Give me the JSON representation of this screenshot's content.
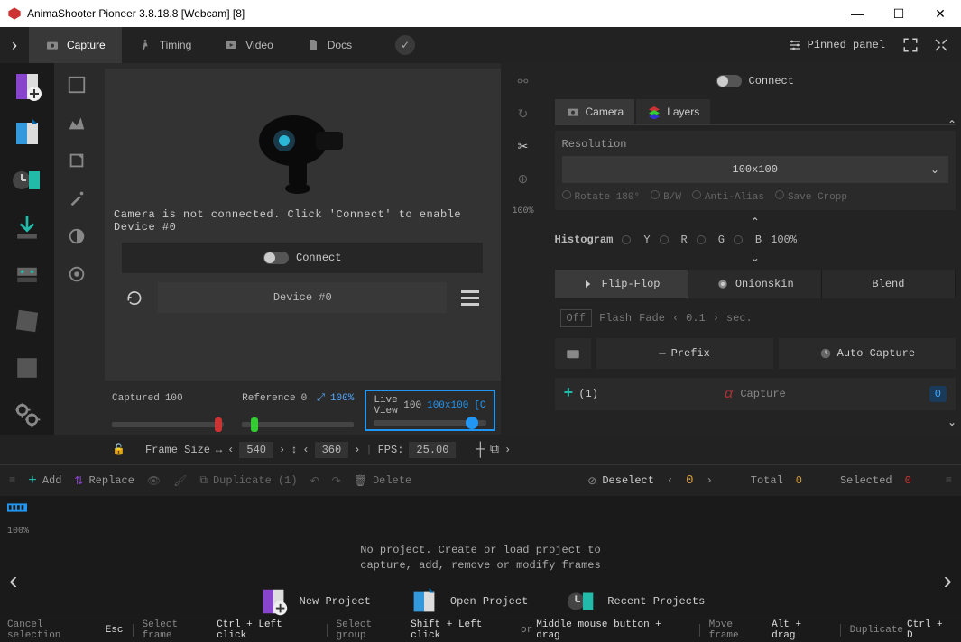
{
  "title": "AnimaShooter Pioneer 3.8.18.8 [Webcam] [8]",
  "tabs": {
    "capture": "Capture",
    "timing": "Timing",
    "video": "Video",
    "docs": "Docs"
  },
  "pinned_panel": "Pinned panel",
  "connect": "Connect",
  "preview": {
    "msg": "Camera is not connected. Click 'Connect' to enable Device #0",
    "connect": "Connect",
    "device": "Device #0"
  },
  "sliders": {
    "captured_label": "Captured",
    "captured_val": "100",
    "reference_label": "Reference",
    "reference_val": "0",
    "ref_pct": "100%",
    "live_label": "Live View",
    "live_val": "100",
    "live_res": "100x100",
    "live_c": "[C"
  },
  "sidecol_pct": "100%",
  "framebar": {
    "frame_size": "Frame Size",
    "w": "540",
    "h": "360",
    "fps_label": "FPS:",
    "fps": "25.00"
  },
  "editbar": {
    "add": "Add",
    "replace": "Replace",
    "duplicate": "Duplicate (1)",
    "delete": "Delete",
    "deselect": "Deselect",
    "cur": "0",
    "total_label": "Total",
    "total": "0",
    "selected_label": "Selected",
    "selected": "0"
  },
  "rightpanel": {
    "camera_tab": "Camera",
    "layers_tab": "Layers",
    "resolution_label": "Resolution",
    "resolution": "100x100",
    "rotate": "Rotate 180°",
    "bw": "B/W",
    "aa": "Anti-Alias",
    "save_crop": "Save Cropp",
    "histogram": "Histogram",
    "y": "Y",
    "r": "R",
    "g": "G",
    "b": "B",
    "hist_pct": "100%",
    "flipflop": "Flip-Flop",
    "onionskin": "Onionskin",
    "blend": "Blend",
    "off": "Off",
    "flash": "Flash",
    "fade": "Fade",
    "fade_val": "0.1",
    "sec": "sec.",
    "prefix": "Prefix",
    "autocap": "Auto Capture",
    "count": "(1)",
    "capture": "Capture",
    "zero": "0"
  },
  "timeline": {
    "pct": "100%",
    "msg": "No project. Create or load project to\ncapture, add, remove or modify frames",
    "new": "New Project",
    "open": "Open Project",
    "recent": "Recent Projects"
  },
  "status": {
    "cancel": "Cancel selection",
    "esc": "Esc",
    "select_frame": "Select frame",
    "ctrl_click": "Ctrl + Left click",
    "select_group": "Select group",
    "shift_click": "Shift + Left click",
    "or": "or",
    "middle": "Middle mouse button + drag",
    "move_frame": "Move frame",
    "alt_drag": "Alt + drag",
    "duplicate": "Duplicate",
    "ctrl_d": "Ctrl + D"
  }
}
